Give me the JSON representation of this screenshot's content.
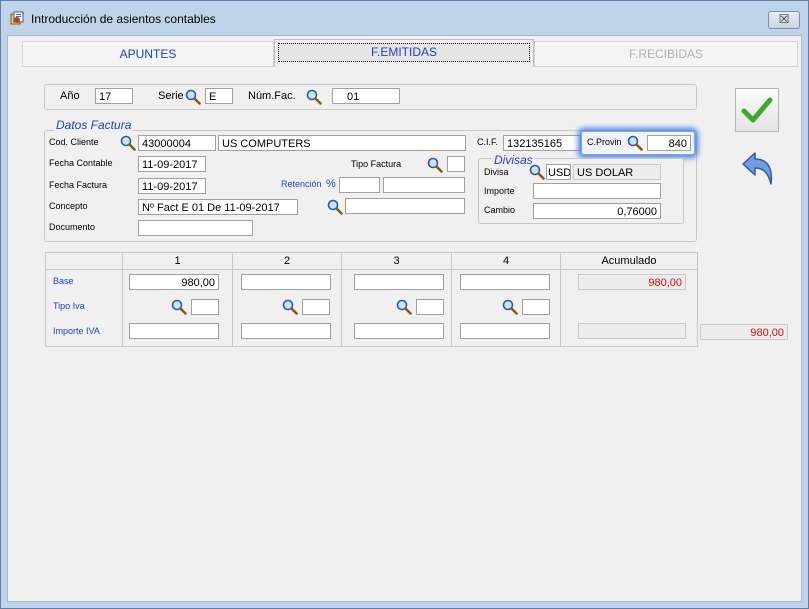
{
  "window": {
    "title": "Introducción de asientos contables",
    "close_label": "☒"
  },
  "tabs": [
    {
      "label": "APUNTES"
    },
    {
      "label": "F.EMITIDAS"
    },
    {
      "label": "F.RECIBIDAS"
    }
  ],
  "header": {
    "anio_label": "Año",
    "anio_value": "17",
    "serie_label": "Serie",
    "serie_value": "E",
    "numfac_label": "Núm.Fac.",
    "numfac_value": "01"
  },
  "datos_factura": {
    "legend": "Datos Factura",
    "cod_cliente_label": "Cod. Cliente",
    "cod_cliente_value": "43000004",
    "cliente_nombre": "US COMPUTERS",
    "cif_label": "C.I.F.",
    "cif_value": "132135165",
    "cprovin_label": "C.Provin",
    "cprovin_value": "840",
    "fecha_contable_label": "Fecha Contable",
    "fecha_contable_value": "11-09-2017",
    "tipo_factura_label": "Tipo Factura",
    "tipo_factura_value": "",
    "fecha_factura_label": "Fecha Factura",
    "fecha_factura_value": "11-09-2017",
    "retencion_label": "Retención",
    "retencion_pct": "%",
    "concepto_label": "Concepto",
    "concepto_value": "Nº Fact E 01 De 11-09-2017",
    "documento_label": "Documento",
    "documento_value": ""
  },
  "divisas": {
    "legend": "Divisas",
    "divisa_label": "Divisa",
    "divisa_code": "USD",
    "divisa_name": "US DOLAR",
    "importe_label": "Importe",
    "importe_value": "",
    "cambio_label": "Cambio",
    "cambio_value": "0,76000"
  },
  "grid": {
    "columns": [
      "1",
      "2",
      "3",
      "4",
      "Acumulado"
    ],
    "row_labels": {
      "base": "Base",
      "tipo_iva": "Tipo Iva",
      "importe_iva": "Importe IVA"
    },
    "base": [
      "980,00",
      "",
      "",
      ""
    ],
    "tipo_iva": [
      "",
      "",
      "",
      ""
    ],
    "importe_iva": [
      "",
      "",
      "",
      ""
    ],
    "acumulado_base": "980,00",
    "acumulado_iva": "",
    "total": "980,00"
  },
  "colors": {
    "accent": "#1e3fc8",
    "red": "#d01010",
    "ok_green": "#3aaa2a",
    "back_blue": "#3a6fc4"
  }
}
